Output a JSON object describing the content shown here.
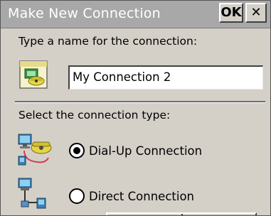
{
  "window": {
    "title": "Make New Connection",
    "ok_label": "OK",
    "close_label": "✕"
  },
  "name_section": {
    "prompt": "Type a name for the connection:",
    "name_value": "My Connection 2",
    "icon": "connection-folder-icon"
  },
  "type_section": {
    "label": "Select the connection type:",
    "options": [
      {
        "label": "Dial-Up Connection",
        "selected": true,
        "icon": "dial-up-phone-icon"
      },
      {
        "label": "Direct Connection",
        "selected": false,
        "icon": "direct-cable-icon"
      }
    ]
  },
  "colors": {
    "title_bar": "#a8a8a8",
    "window_bg": "#d4d0c8",
    "title_text": "#ffffff"
  }
}
